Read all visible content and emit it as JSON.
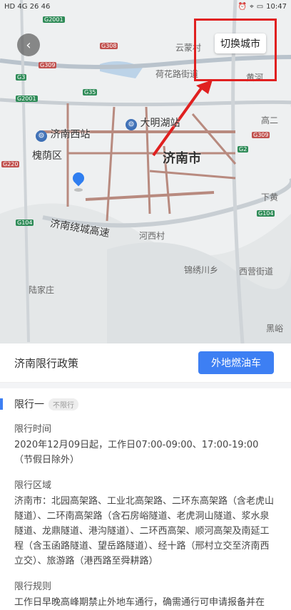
{
  "status_bar": {
    "left": "HD 4G 26 46",
    "time": "10:47"
  },
  "map": {
    "city_label": "济南市",
    "labels": {
      "station_west": "济南西站",
      "daming_lake": "大明湖站",
      "huaiyin": "槐荫区",
      "ring_expressway": "济南绕城高速",
      "yunmengcun": "云蒙村",
      "hehuaroad": "荷花路街道",
      "huanghe": "黄河",
      "erqi": "高二",
      "xiahuang": "下黄",
      "jinxiu": "锦绣川乡",
      "xiying": "西营街道",
      "liujiazhuang": "陆家庄",
      "hehe": "河西村",
      "hei": "黑峪"
    },
    "road_badges": [
      "G2001",
      "G308",
      "G3",
      "G309",
      "G35",
      "G2001",
      "G220",
      "G104",
      "G2",
      "G309",
      "G104"
    ]
  },
  "buttons": {
    "switch_city": "切换城市"
  },
  "policy": {
    "title": "济南限行政策",
    "outside_car_button": "外地燃油车",
    "section_title": "限行一",
    "section_badge": "不限行",
    "time_label": "限行时间",
    "time_value": "2020年12月09日起，工作日07:00-09:00、17:00-19:00（节假日除外）",
    "area_label": "限行区域",
    "area_value": "济南市：北园高架路、工业北高架路、二环东高架路（含老虎山隧道）、二环南高架路（含石房峪隧道、老虎洞山隧道、浆水泉隧道、龙鼎隧道、港沟隧道）、二环西高架、顺河高架及南延工程（含玉函路隧道、望岳路隧道）、经十路（邢村立交至济南西立交）、旅游路（港西路至舜耕路）",
    "rule_label": "限行规则",
    "rule_value": "工作日早晚高峰期禁止外地车通行，确需通行可申请报备并在"
  }
}
